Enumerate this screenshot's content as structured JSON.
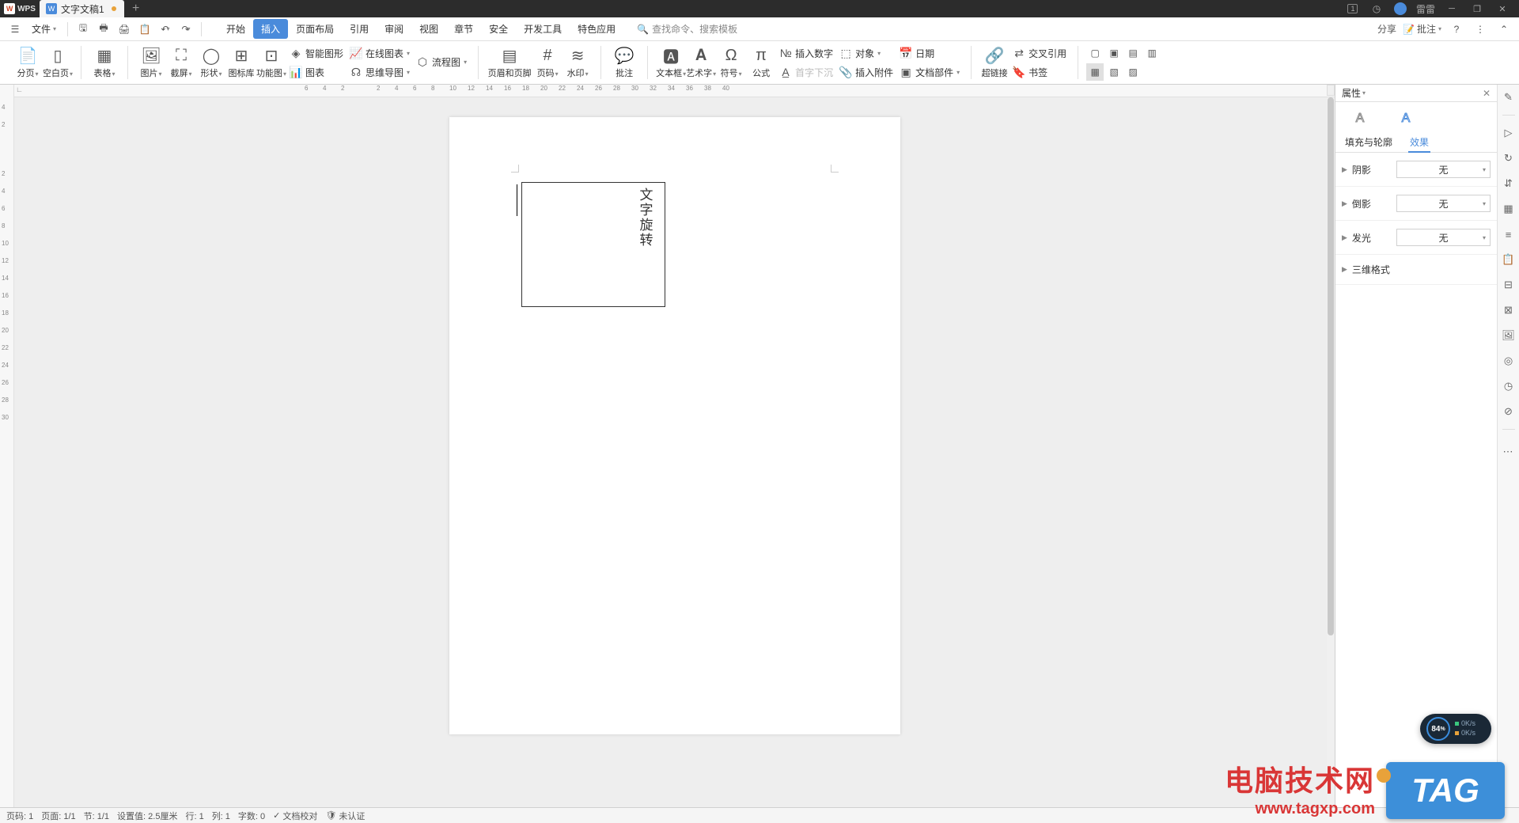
{
  "title_bar": {
    "app_name": "WPS",
    "doc_name": "文字文稿1",
    "user_name": "雷雷",
    "badge": "1"
  },
  "menubar": {
    "file_label": "文件",
    "tabs": [
      "开始",
      "插入",
      "页面布局",
      "引用",
      "审阅",
      "视图",
      "章节",
      "安全",
      "开发工具",
      "特色应用"
    ],
    "active_tab_index": 1,
    "search_placeholder": "查找命令、搜索模板",
    "share": "分享",
    "annotate": "批注"
  },
  "ribbon": {
    "page_break": "分页",
    "blank_page": "空白页",
    "table": "表格",
    "picture": "图片",
    "screenshot": "截屏",
    "shapes": "形状",
    "icon_lib": "图标库",
    "smart_graphic": "功能图",
    "smart_shape": "智能图形",
    "online_chart": "在线图表",
    "flowchart": "流程图",
    "mindmap": "思维导图",
    "chart": "图表",
    "header_footer": "页眉和页脚",
    "page_number": "页码",
    "watermark": "水印",
    "comment": "批注",
    "textbox": "文本框",
    "wordart": "艺术字",
    "symbol": "符号",
    "equation": "公式",
    "insert_number": "插入数字",
    "object": "对象",
    "date": "日期",
    "drop_cap": "首字下沉",
    "attachment": "插入附件",
    "doc_parts": "文档部件",
    "hyperlink": "超链接",
    "cross_ref": "交叉引用",
    "bookmark": "书签"
  },
  "ruler": {
    "horizontal": [
      "6",
      "4",
      "2",
      "",
      "2",
      "4",
      "6",
      "8",
      "10",
      "12",
      "14",
      "16",
      "18",
      "20",
      "22",
      "24",
      "26",
      "28",
      "30",
      "32",
      "34",
      "36",
      "38",
      "40"
    ],
    "vertical_top": [
      "4",
      "2"
    ],
    "vertical": [
      "2",
      "4",
      "6",
      "8",
      "10",
      "12",
      "14",
      "16",
      "18",
      "20",
      "22",
      "24",
      "26",
      "28",
      "30"
    ]
  },
  "document": {
    "textbox_content": "文字旋转"
  },
  "properties": {
    "title": "属性",
    "subtab_fill": "填充与轮廓",
    "subtab_effects": "效果",
    "sections": {
      "shadow": {
        "label": "阴影",
        "value": "无"
      },
      "reflection": {
        "label": "倒影",
        "value": "无"
      },
      "glow": {
        "label": "发光",
        "value": "无"
      },
      "format3d": {
        "label": "三维格式"
      }
    }
  },
  "statusbar": {
    "page_num": "页码: 1",
    "page_count": "页面: 1/1",
    "section": "节: 1/1",
    "position": "设置值: 2.5厘米",
    "line": "行: 1",
    "col": "列: 1",
    "words": "字数: 0",
    "spellcheck": "文档校对",
    "not_auth": "未认证"
  },
  "floating": {
    "gauge_value": "84",
    "gauge_unit": "%",
    "net_up": "0K/s",
    "net_down": "0K/s"
  },
  "watermark": {
    "line1": "电脑技术网",
    "line2": "www.tagxp.com",
    "tag": "TAG"
  }
}
